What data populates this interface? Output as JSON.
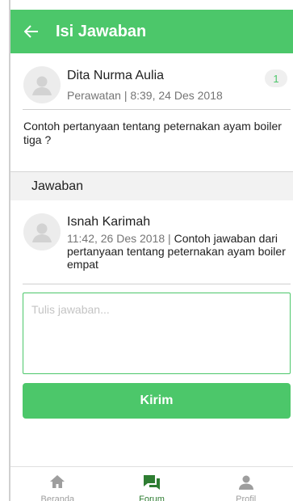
{
  "header": {
    "title": "Isi Jawaban",
    "back_icon": "arrow-left-icon"
  },
  "post": {
    "author": "Dita Nurma Aulia",
    "meta": "Perawatan | 8:39, 24 Des 2018",
    "answer_count": "1",
    "question": "Contoh pertanyaan tentang peternakan ayam boiler tiga ?"
  },
  "answers_section": {
    "title": "Jawaban"
  },
  "answers": [
    {
      "author": "Isnah Karimah",
      "time": "11:42, 26 Des 2018",
      "separator": " | ",
      "text": "Contoh jawaban dari pertanyaan tentang peternakan ayam boiler empat"
    }
  ],
  "reply": {
    "placeholder": "Tulis jawaban...",
    "value": "",
    "submit_label": "Kirim"
  },
  "bottom_nav": [
    {
      "label": "Beranda",
      "icon": "home-icon",
      "active": false
    },
    {
      "label": "Forum",
      "icon": "forum-chat-icon",
      "active": true
    },
    {
      "label": "Profil",
      "icon": "profile-person-icon",
      "active": false
    }
  ],
  "colors": {
    "primary": "#4cc76a",
    "nav_active": "#2e7d32",
    "nav_inactive": "#9e9e9e",
    "muted_text": "#757575"
  }
}
